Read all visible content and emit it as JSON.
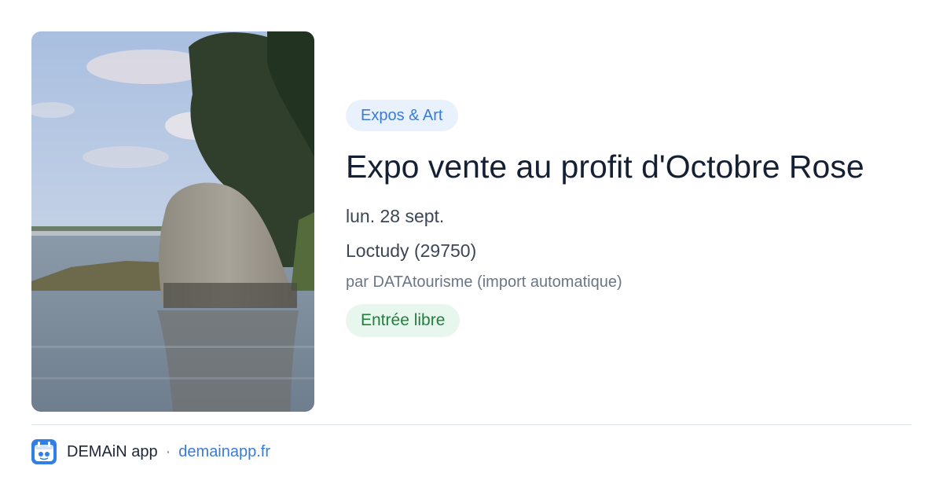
{
  "colors": {
    "category_bg": "#e9f1fd",
    "category_text": "#3a7bd5",
    "title_text": "#152033",
    "price_bg": "#e8f7ee",
    "price_text": "#21803f",
    "link": "#3a7bd5"
  },
  "event": {
    "category": "Expos & Art",
    "title": "Expo vente au profit d'Octobre Rose",
    "date": "lun. 28 sept.",
    "location": "Loctudy (29750)",
    "author": "par DATAtourisme (import automatique)",
    "price": "Entrée libre"
  },
  "footer": {
    "app_name": "DEMAiN app",
    "separator": "·",
    "domain": "demainapp.fr",
    "app_icon": "demain-app-icon"
  }
}
